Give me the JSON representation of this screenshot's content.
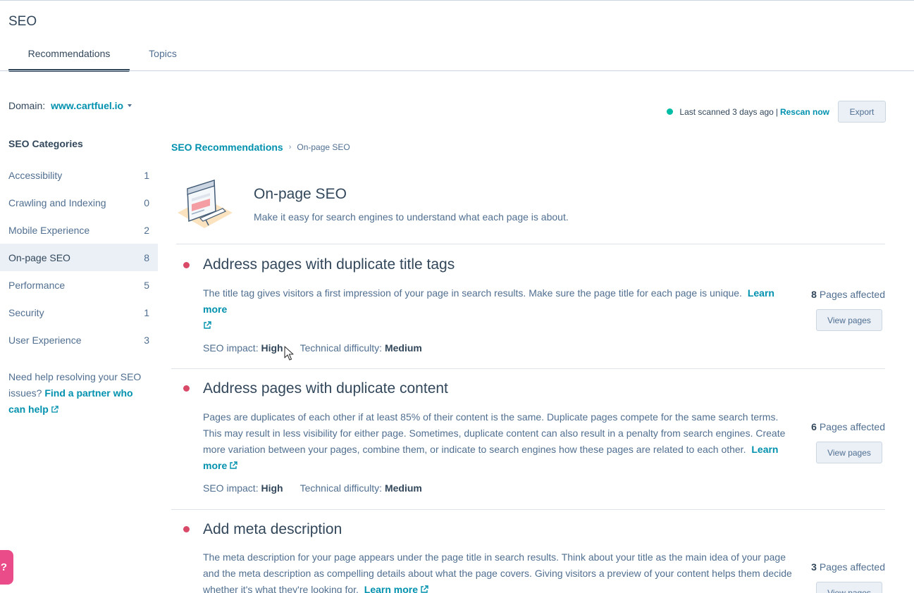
{
  "page": {
    "title": "SEO"
  },
  "tabs": [
    {
      "label": "Recommendations",
      "active": true
    },
    {
      "label": "Topics",
      "active": false
    }
  ],
  "domain": {
    "label": "Domain:",
    "value": "www.cartfuel.io"
  },
  "scan": {
    "status_text": "Last scanned 3 days ago",
    "separator": "|",
    "rescan_label": "Rescan now",
    "status_color": "#00bda5"
  },
  "toolbar": {
    "export_label": "Export"
  },
  "sidebar": {
    "heading": "SEO Categories",
    "categories": [
      {
        "label": "Accessibility",
        "count": "1"
      },
      {
        "label": "Crawling and Indexing",
        "count": "0"
      },
      {
        "label": "Mobile Experience",
        "count": "2"
      },
      {
        "label": "On-page SEO",
        "count": "8",
        "active": true
      },
      {
        "label": "Performance",
        "count": "5"
      },
      {
        "label": "Security",
        "count": "1"
      },
      {
        "label": "User Experience",
        "count": "3"
      }
    ],
    "help_text": "Need help resolving your SEO issues?",
    "help_link": "Find a partner who can help"
  },
  "breadcrumb": {
    "root": "SEO Recommendations",
    "separator": "›",
    "current": "On-page SEO"
  },
  "hero": {
    "title": "On-page SEO",
    "description": "Make it easy for search engines to understand what each page is about."
  },
  "recommendations": [
    {
      "title": "Address pages with duplicate title tags",
      "description": "The title tag gives visitors a first impression of your page in search results. Make sure the page title for each page is unique.",
      "learn_more": "Learn more",
      "pages_count": "8",
      "pages_label": "Pages affected",
      "view_label": "View pages",
      "impact_label": "SEO impact:",
      "impact_value": "High",
      "difficulty_label": "Technical difficulty:",
      "difficulty_value": "Medium"
    },
    {
      "title": "Address pages with duplicate content",
      "description": "Pages are duplicates of each other if at least 85% of their content is the same. Duplicate pages compete for the same search terms. This may result in less visibility for either page. Sometimes, duplicate content can also result in a penalty from search engines. Create more variation between your pages, combine them, or indicate to search engines how these pages are related to each other.",
      "learn_more": "Learn more",
      "pages_count": "6",
      "pages_label": "Pages affected",
      "view_label": "View pages",
      "impact_label": "SEO impact:",
      "impact_value": "High",
      "difficulty_label": "Technical difficulty:",
      "difficulty_value": "Medium"
    },
    {
      "title": "Add meta description",
      "description": "The meta description for your page appears under the page title in search results. Think about your title as the main idea of your page and the meta description as compelling details about what the page covers. Giving visitors a preview of your content helps them decide whether it's what they're looking for.",
      "learn_more": "Learn more",
      "pages_count": "3",
      "pages_label": "Pages affected",
      "view_label": "View pages"
    }
  ],
  "help_bubble": {
    "label": "?"
  },
  "colors": {
    "accent": "#0091ae",
    "text": "#33475b",
    "muted": "#516f90",
    "priority_dot": "#d84a68",
    "bubble": "#ea4c89"
  }
}
